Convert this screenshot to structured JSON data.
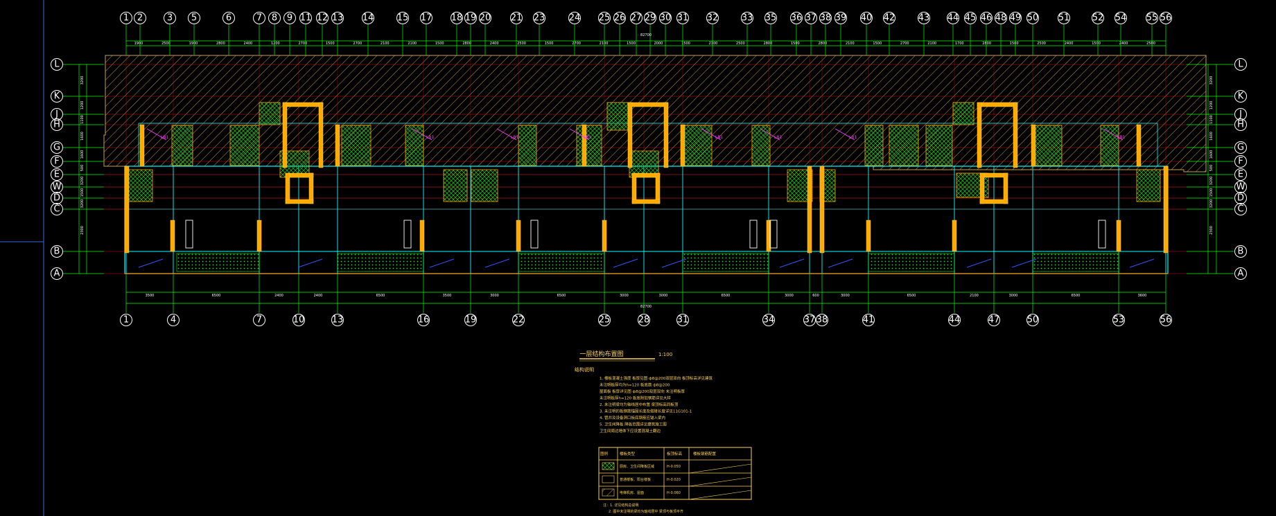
{
  "drawing": {
    "title": "一层结构布置图",
    "scale": "1:100",
    "notes_title": "结构说明",
    "notes": [
      "1. 楼板混凝土强度  板厚见图  ф8@200双层双向  板顶标高详见建筑",
      "   未注明板厚均为h=120  板底筋  ф8@200",
      "   屋面板  板厚详见图  ф8@200双层双向  未注明板厚",
      "   未注明板厚h=120  板底附加钢筋详见大样",
      "2. 未注明梁均为轴线居中布置  梁顶标高同板顶",
      "3. 未注明的板钢筋锚固长度及搭接长度详见11G101-1",
      "4. 管井及设备洞口板底钢筋应锚入梁内",
      "5. 卫生间降板  降板范围详见建筑施工图",
      "   卫生间周边墙体下应设置混凝土翻边"
    ],
    "bottom_notes": [
      "注：1. 详见结构总说明",
      "2. 图中未注明的梁均为轴线居中  梁顶与板顶平齐"
    ],
    "legend": {
      "headers": [
        "图例",
        "楼板类型",
        "板顶标高",
        "楼板钢筋配置"
      ],
      "rows": [
        {
          "type": "厨房、卫生间降板区域",
          "elev": "H-0.050"
        },
        {
          "type": "普通楼板、阳台楼板",
          "elev": "H-0.020"
        },
        {
          "type": "电梯机房、屋面",
          "elev": "H-0.060"
        }
      ]
    }
  },
  "axes": {
    "top_labels": [
      "1",
      "2",
      "3",
      "5",
      "6",
      "7",
      "8",
      "9",
      "11",
      "12",
      "13",
      "14",
      "15",
      "17",
      "18",
      "19",
      "20",
      "21",
      "23",
      "24",
      "25",
      "26",
      "27",
      "29",
      "30",
      "31",
      "32",
      "33",
      "35",
      "36",
      "37",
      "38",
      "39",
      "40",
      "42",
      "43",
      "44",
      "45",
      "46",
      "48",
      "49",
      "50",
      "51",
      "52",
      "54",
      "55",
      "56"
    ],
    "bottom_labels": [
      "1",
      "4",
      "7",
      "10",
      "13",
      "16",
      "19",
      "22",
      "25",
      "28",
      "31",
      "34",
      "37",
      "38",
      "41",
      "44",
      "47",
      "50",
      "53",
      "56"
    ],
    "row_labels": [
      "L",
      "K",
      "J",
      "H",
      "G",
      "F",
      "E",
      "W",
      "D",
      "C",
      "B",
      "A"
    ],
    "right_row_labels": [
      "L",
      "K",
      "J",
      "H",
      "G",
      "F",
      "E",
      "W",
      "D",
      "C",
      "B",
      "A"
    ],
    "top_overall_dim": "82700",
    "bottom_overall_dim": "82700",
    "top_dims": [
      "1900",
      "2500",
      "1900",
      "2800",
      "2400",
      "1200",
      "2700",
      "1500",
      "2700",
      "2100",
      "2100",
      "1500",
      "2800",
      "2400",
      "2500",
      "1500",
      "2700",
      "2100",
      "1500",
      "2000",
      "1500",
      "2100",
      "2500",
      "2800",
      "1500",
      "2800",
      "2100",
      "1500",
      "2700",
      "2100",
      "1700",
      "2800",
      "1500",
      "2500",
      "2400",
      "1500",
      "2400",
      "2500"
    ],
    "bottom_dims": [
      "3500",
      "6500",
      "2400",
      "2400",
      "6500",
      "3500",
      "3000",
      "6500",
      "3000",
      "3000",
      "6500",
      "3000",
      "600",
      "3000",
      "6500",
      "2100",
      "3000",
      "6500",
      "3600"
    ],
    "left_dims": [
      "3200",
      "1200",
      "1100",
      "1600",
      "1600",
      "500",
      "3200",
      "1500",
      "3200",
      "2300"
    ],
    "right_dims": [
      "3200",
      "1200",
      "1100",
      "1600",
      "1600",
      "500",
      "3200",
      "1500",
      "3200",
      "2300"
    ]
  },
  "room_tags": [
    "LB1",
    "LB1",
    "LB1",
    "LB1",
    "LB1",
    "LB1",
    "LB1",
    "LB1"
  ],
  "colors": {
    "background": "#000000",
    "axis_circle": "#ffffff",
    "dim_line": "#00ff00",
    "grid_line": "#ff0000",
    "wall": "#00ffff",
    "column": "#ffaa00",
    "beam": "#ffd25a",
    "hatch": "#c8a050",
    "slab_hatch": "#00aa00",
    "dots": "#00ff00",
    "magenta": "#ff33ff",
    "blue": "#3355ff",
    "text": "#ffd25a"
  }
}
